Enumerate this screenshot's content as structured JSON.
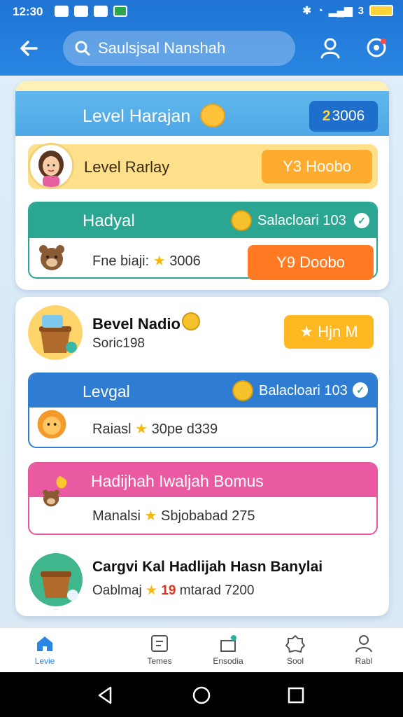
{
  "status": {
    "time": "12:30",
    "carrier_text": "3"
  },
  "header": {
    "search_value": "Saulsjsal Nanshah"
  },
  "card1": {
    "title": "Level Harajan",
    "count_prefix": "2",
    "count_rest": " 3006",
    "row": {
      "label": "Level Rarlay",
      "button": "Y3 Hoobo"
    },
    "sub": {
      "title": "Hadyal",
      "right_text": "Salacloari 103",
      "line": "Fne biaji:",
      "line_value": "3006",
      "button": "Y9 Doobo"
    }
  },
  "card2": {
    "title": "Bevel Nadio",
    "subtitle": "Soric198",
    "button": "Hjn M",
    "blue": {
      "title": "Levgal",
      "right_text": "Balacloari 103",
      "line_a": "Raiasl",
      "line_b": "30pe d339"
    },
    "pink": {
      "title": "Hadijhah Iwaljah Bomus",
      "line_a": "Manalsi",
      "line_b": "Sbjobabad 275"
    },
    "bottom": {
      "title": "Cargvi Kal Hadlijah Hasn Banylai",
      "line_a": "Oablmaj",
      "line_num": "19",
      "line_b": "mtarad 7200"
    }
  },
  "nav": [
    {
      "label": "Levie",
      "icon": "home-icon"
    },
    {
      "label": "Temes",
      "icon": "message-icon"
    },
    {
      "label": "Ensodia",
      "icon": "gift-icon"
    },
    {
      "label": "Sool",
      "icon": "badge-icon"
    },
    {
      "label": "Rabl",
      "icon": "profile-icon"
    }
  ],
  "colors": {
    "accent": "#2a86e2",
    "orange": "#ff7a22",
    "teal": "#2aa693",
    "pink": "#ea5aa2"
  }
}
